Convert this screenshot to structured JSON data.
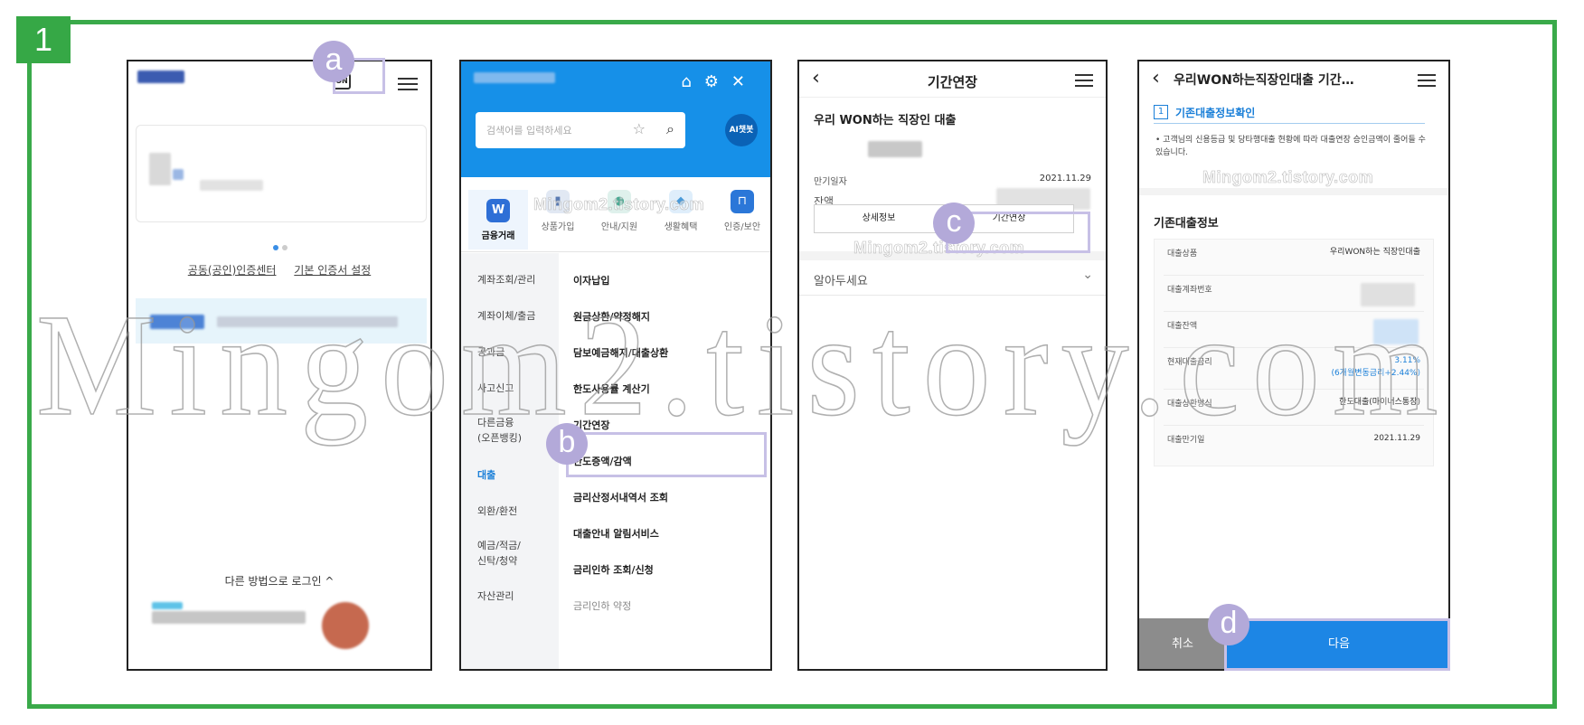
{
  "step": {
    "number": "1"
  },
  "watermark": {
    "main": "Mingom2.tistory.com",
    "small": "Mingom2.tistory.com"
  },
  "markers": {
    "a": "a",
    "b": "b",
    "c": "c",
    "d": "d"
  },
  "screen1": {
    "on_icon": "ON",
    "menu_icon": "hamburger-icon",
    "links": [
      "공동(공인)인증센터",
      "기본 인증서 설정"
    ],
    "other_login": "다른 방법으로 로그인 ^"
  },
  "screen2": {
    "search_placeholder": "검색어를 입력하세요",
    "ai_chat": "AI챗봇",
    "header_icons": [
      "home-icon",
      "gear-icon",
      "close-icon"
    ],
    "categories": [
      "금융거래",
      "상품가입",
      "안내/지원",
      "생활혜택",
      "인증/보안"
    ],
    "left_menu": [
      "계좌조회/관리",
      "계좌이체/출금",
      "공과금",
      "사고신고",
      "다른금융\n(오픈뱅킹)",
      "대출",
      "외환/환전",
      "예금/적금/\n신탁/청약",
      "자산관리"
    ],
    "right_menu": [
      "이자납입",
      "원금상환/약정해지",
      "담보예금해지/대출상환",
      "한도사용률 계산기",
      "기간연장",
      "한도증액/감액",
      "금리산정서내역서 조회",
      "대출안내 알림서비스",
      "금리인하 조회/신청",
      "금리인하 약정"
    ]
  },
  "screen3": {
    "title": "기간연장",
    "product": "우리 WON하는 직장인 대출",
    "due_label": "만기일자",
    "due_value": "2021.11.29",
    "balance_label": "잔액",
    "btn_detail": "상세정보",
    "btn_extend": "기간연장",
    "notice": "알아두세요"
  },
  "screen4": {
    "title": "우리WON하는직장인대출 기간…",
    "section_num": "1",
    "section_title": "기존대출정보확인",
    "note": "고객님의 신용등급 및 당타행대출 현황에 따라 대출연장 승인금액이 줄어들 수 있습니다.",
    "info_head": "기존대출정보",
    "rows": [
      {
        "label": "대출상품",
        "value": "우리WON하는 직장인대출"
      },
      {
        "label": "대출계좌번호",
        "value": ""
      },
      {
        "label": "대출잔액",
        "value": ""
      },
      {
        "label": "현재대출금리",
        "value": "3.11%",
        "value2": "(6개월변동금리+2.44%)"
      },
      {
        "label": "대출상환방식",
        "value": "한도대출(마이너스통장)"
      },
      {
        "label": "대출만기일",
        "value": "2021.11.29"
      }
    ],
    "cancel": "취소",
    "next": "다음"
  },
  "colors": {
    "frame_green": "#3aaa4a",
    "marker": "#b3a9d9",
    "primary_blue": "#1d86e5"
  }
}
